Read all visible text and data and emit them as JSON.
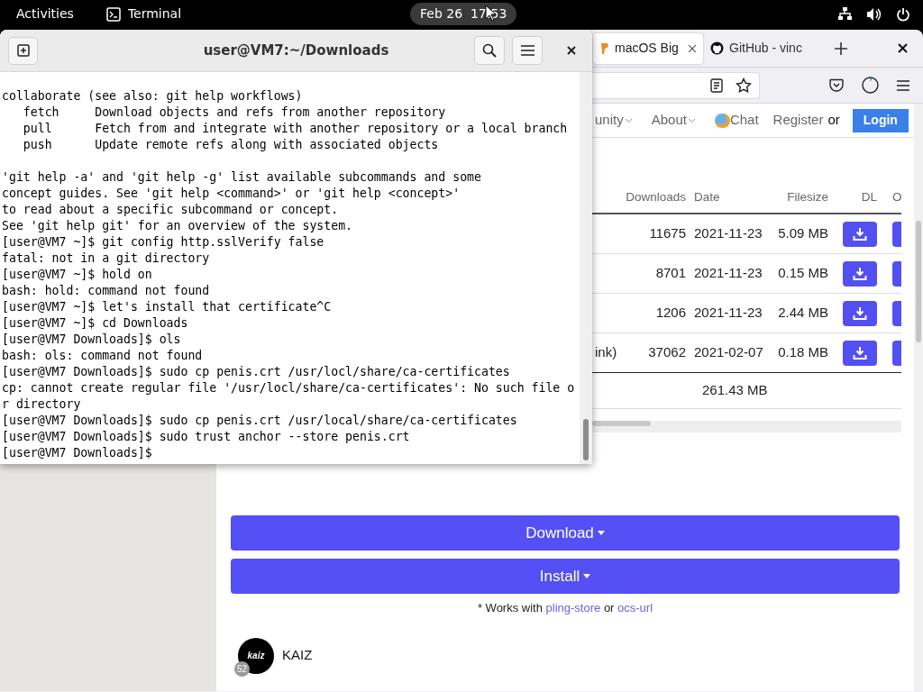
{
  "top_bar": {
    "activities": "Activities",
    "app": "Terminal",
    "clock": "Feb 26  17:53"
  },
  "browser": {
    "tabs": [
      {
        "label": "macOS Big",
        "selected": true
      },
      {
        "label": "GitHub - vinc",
        "selected": false
      }
    ],
    "nav": [
      {
        "label": "unity",
        "kind": "menu"
      },
      {
        "label": "About",
        "kind": "menu"
      },
      {
        "label": "Chat",
        "kind": "chat"
      },
      {
        "label": "Register",
        "kind": "link"
      },
      {
        "label": "or",
        "kind": "text"
      },
      {
        "label": "Login",
        "kind": "button"
      }
    ],
    "table": {
      "columns": [
        "Downloads",
        "Date",
        "Filesize",
        "DL",
        "O"
      ],
      "rows": [
        {
          "name": "",
          "downloads": "11675",
          "date": "2021-11-23",
          "filesize": "5.09 MB"
        },
        {
          "downloads": "8701",
          "date": "2021-11-23",
          "filesize": "0.15 MB"
        },
        {
          "downloads": "1206",
          "date": "2021-11-23",
          "filesize": "2.44 MB"
        },
        {
          "name": "ink)",
          "downloads": "37062",
          "date": "2021-02-07",
          "filesize": "0.18 MB"
        }
      ],
      "total": "261.43 MB"
    },
    "buttons": [
      "Download",
      "Install"
    ],
    "works_with": {
      "prefix": "* Works with",
      "link1": "pling-store",
      "middle": "or",
      "link2": "ocs-url"
    },
    "author": {
      "name": "KAIZ",
      "avatar_text": "kaiz",
      "badge": "52"
    }
  },
  "terminal": {
    "title": "user@VM7:~/Downloads",
    "blocks": [
      [
        "collaborate (see also: git help workflows)",
        "   fetch     Download objects and refs from another repository",
        "   pull      Fetch from and integrate with another repository or a local branch",
        "   push      Update remote refs along with associated objects"
      ],
      [
        "'git help -a' and 'git help -g' list available subcommands and some",
        "concept guides. See 'git help <command>' or 'git help <concept>'",
        "to read about a specific subcommand or concept.",
        "See 'git help git' for an overview of the system.",
        "[user@VM7 ~]$ git config http.sslVerify false",
        "fatal: not in a git directory",
        "[user@VM7 ~]$ hold on",
        "bash: hold: command not found",
        "[user@VM7 ~]$ let's install that certificate^C",
        "[user@VM7 ~]$ cd Downloads",
        "[user@VM7 Downloads]$ ols",
        "bash: ols: command not found",
        "[user@VM7 Downloads]$ sudo cp penis.crt /usr/locl/share/ca-certificates",
        "cp: cannot create regular file '/usr/locl/share/ca-certificates': No such file o",
        "r directory",
        "[user@VM7 Downloads]$ sudo cp penis.crt /usr/local/share/ca-certificates",
        "[user@VM7 Downloads]$ sudo trust anchor --store penis.crt",
        "[user@VM7 Downloads]$"
      ]
    ]
  }
}
